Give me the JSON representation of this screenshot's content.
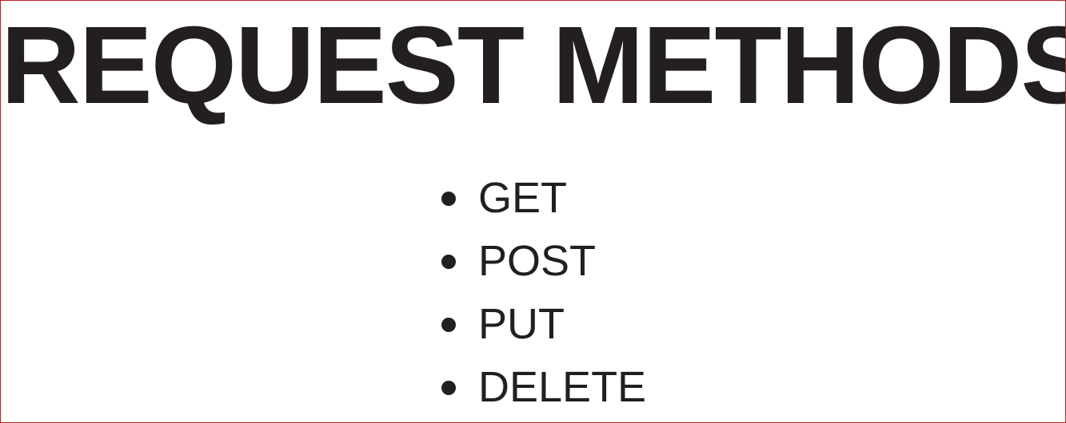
{
  "title": "REQUEST METHODS",
  "methods": [
    {
      "label": "GET"
    },
    {
      "label": "POST"
    },
    {
      "label": "PUT"
    },
    {
      "label": "DELETE"
    }
  ],
  "colors": {
    "text": "#231f20",
    "border": "#b22222",
    "background": "#ffffff"
  }
}
